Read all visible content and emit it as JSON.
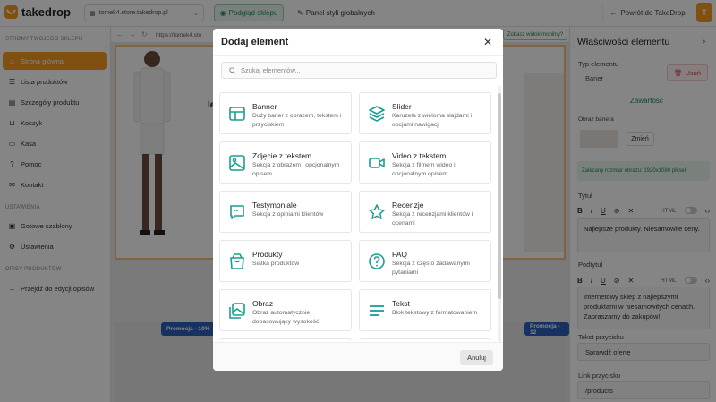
{
  "app": {
    "logo_text": "takedrop",
    "avatar_initial": "T"
  },
  "header": {
    "store_name": "tomek4.store.takedrop.pl",
    "preview_label": "Podgląd sklepu",
    "styles_label": "Panel styli globalnych",
    "back_label": "Powrót do TakeDrop"
  },
  "sidebar": {
    "section_store": "STRONY TWOJEGO SKLEPU",
    "items": [
      {
        "label": "Strona główna",
        "icon": "home-icon"
      },
      {
        "label": "Lista produktów",
        "icon": "list-icon"
      },
      {
        "label": "Szczegóły produktu",
        "icon": "details-icon"
      },
      {
        "label": "Koszyk",
        "icon": "cart-icon"
      },
      {
        "label": "Kasa",
        "icon": "checkout-icon"
      },
      {
        "label": "Pomoc",
        "icon": "help-icon"
      },
      {
        "label": "Kontakt",
        "icon": "mail-icon"
      }
    ],
    "section_settings": "USTAWIENIA",
    "settings_items": [
      {
        "label": "Gotowe szablony",
        "icon": "template-icon"
      },
      {
        "label": "Ustawienia",
        "icon": "gear-icon"
      }
    ],
    "section_desc": "OPISY PRODUKTÓW",
    "desc_items": [
      {
        "label": "Przejdź do edycji opisów",
        "icon": "arrow-right-icon"
      }
    ]
  },
  "canvas": {
    "url": "https://tomek4.sto",
    "mobile_label": "Zobacz widok mobilny?",
    "hero_title": "Ie",
    "promo_left": "Promocja - 10%",
    "promo_right": "Promocja - 12"
  },
  "properties": {
    "title": "Właściwości elementu",
    "type_label": "Typ elementu",
    "type_value": "Baner",
    "delete_label": "Usuń",
    "content_tab": "Zawartość",
    "image_label": "Obraz banera",
    "change_label": "Zmień",
    "size_note": "Zalecany rozmiar obrazu: 1920x1080 pikseli",
    "title_label": "Tytuł",
    "title_value": "Najlepsze produkty. Niesamowite ceny.",
    "subtitle_label": "Podtytuł",
    "subtitle_value": "Internetowy sklep z najlepszymi produktami w niesamowitych cenach. Zapraszamy do zakupów!",
    "html_label": "HTML",
    "button_text_label": "Tekst przycisku",
    "button_text_value": "Sprawdź ofertę",
    "button_link_label": "Link przycisku",
    "button_link_value": "/products"
  },
  "modal": {
    "title": "Dodaj element",
    "search_placeholder": "Szukaj elementów...",
    "cancel_label": "Anuluj",
    "items": [
      {
        "title": "Banner",
        "desc": "Duży baner z obrazem, tekstem i przyciskiem",
        "icon": "banner-icon"
      },
      {
        "title": "Slider",
        "desc": "Karuzela z wieloma slajdami i opcjami nawigacji",
        "icon": "slider-icon"
      },
      {
        "title": "Zdjęcie z tekstem",
        "desc": "Sekcja z obrazem i opcjonalnym opisem",
        "icon": "image-text-icon"
      },
      {
        "title": "Video z tekstem",
        "desc": "Sekcja z filmem wideo i opcjonalnym opisem",
        "icon": "video-icon"
      },
      {
        "title": "Testymoniale",
        "desc": "Sekcja z opiniami klientów",
        "icon": "testimonial-icon"
      },
      {
        "title": "Recenzje",
        "desc": "Sekcja z recenzjami klientów i ocenami",
        "icon": "star-icon"
      },
      {
        "title": "Produkty",
        "desc": "Siatka produktów",
        "icon": "products-icon"
      },
      {
        "title": "FAQ",
        "desc": "Sekcja z często zadawanymi pytaniami",
        "icon": "faq-icon"
      },
      {
        "title": "Obraz",
        "desc": "Obraz automatycznie dopasowujący wysokość",
        "icon": "gallery-icon"
      },
      {
        "title": "Tekst",
        "desc": "Blok tekstowy z formatowaniem",
        "icon": "text-icon"
      }
    ]
  },
  "colors": {
    "accent": "#f39a1e",
    "green": "#1f8b57",
    "teal_icon": "#1a9e8f"
  }
}
